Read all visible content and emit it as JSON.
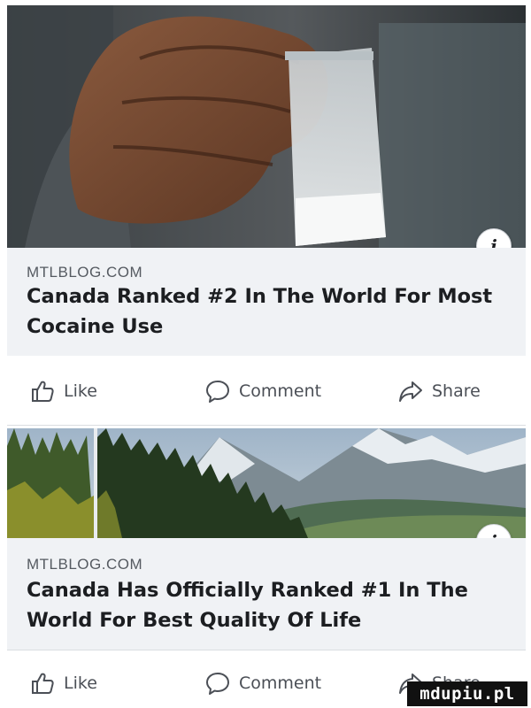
{
  "posts": [
    {
      "domain": "MTLBLOG.COM",
      "headline": "Canada Ranked #2 In The World For Most Cocaine Use",
      "image_subject": "hand-holding-bag-photo",
      "info_icon_glyph": "i"
    },
    {
      "domain": "MTLBLOG.COM",
      "headline": "Canada Has Officially Ranked #1 In The World For Best Quality Of Life",
      "image_subject": "mountain-forest-landscape-photo",
      "info_icon_glyph": "i"
    }
  ],
  "actions": {
    "like_label": "Like",
    "comment_label": "Comment",
    "share_label": "Share"
  },
  "watermark": "mdupiu.pl",
  "colors": {
    "link_panel_bg": "#f0f2f5",
    "text_primary": "#1c1e21",
    "text_secondary": "#4b4f56",
    "domain_gray": "#555a61"
  },
  "icons": [
    "thumbs-up-icon",
    "comment-bubble-icon",
    "share-arrow-icon",
    "info-icon"
  ]
}
